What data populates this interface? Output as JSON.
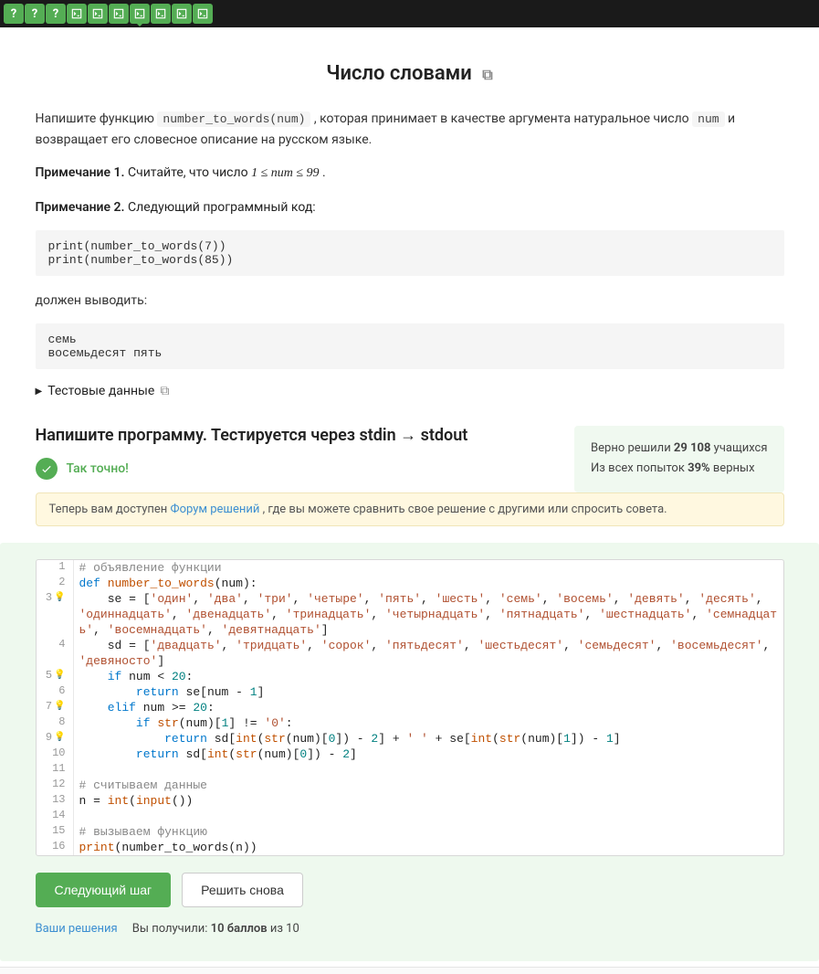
{
  "topbar": {
    "tabs": [
      {
        "kind": "q"
      },
      {
        "kind": "q"
      },
      {
        "kind": "q"
      },
      {
        "kind": "t"
      },
      {
        "kind": "t"
      },
      {
        "kind": "t"
      },
      {
        "kind": "t",
        "active": true
      },
      {
        "kind": "t"
      },
      {
        "kind": "t"
      },
      {
        "kind": "t"
      }
    ]
  },
  "title": "Число словами",
  "desc": {
    "pre": "Напишите функцию ",
    "code1": "number_to_words(num)",
    "mid": " , которая принимает в качестве аргумента натуральное число ",
    "code2": "num",
    "post": " и возвращает его словесное описание на русском языке."
  },
  "note1": {
    "label": "Примечание 1.",
    "text": " Считайте, что число ",
    "math": "1 ≤ num ≤ 99",
    "end": "."
  },
  "note2": {
    "label": "Примечание 2.",
    "text": " Следующий программный код:"
  },
  "code_example": "print(number_to_words(7))\nprint(number_to_words(85))",
  "should_output": "должен выводить:",
  "output_example": "семь\nвосемьдесят пять",
  "test_data": "Тестовые данные",
  "section_title": "Напишите программу. Тестируется через stdin → stdout",
  "correct": "Так точно!",
  "forum": {
    "pre": "Теперь вам доступен ",
    "link": "Форум решений",
    "post": " , где вы можете сравнить свое решение с другими или спросить совета."
  },
  "stats": {
    "line1_pre": "Верно решили ",
    "line1_b": "29 108",
    "line1_post": " учащихся",
    "line2_pre": "Из всех попыток ",
    "line2_b": "39%",
    "line2_post": " верных"
  },
  "code": {
    "lines": [
      {
        "n": 1,
        "bulb": false,
        "html": "<span class='c-comment'># объявление функции</span>"
      },
      {
        "n": 2,
        "bulb": false,
        "html": "<span class='c-kw'>def</span> <span class='c-def'>number_to_words</span>(num):"
      },
      {
        "n": 3,
        "bulb": true,
        "html": "    se = [<span class='c-str'>'один'</span>, <span class='c-str'>'два'</span>, <span class='c-str'>'три'</span>, <span class='c-str'>'четыре'</span>, <span class='c-str'>'пять'</span>, <span class='c-str'>'шесть'</span>, <span class='c-str'>'семь'</span>, <span class='c-str'>'восемь'</span>, <span class='c-str'>'девять'</span>, <span class='c-str'>'десять'</span>, <span class='c-str'>'одиннадцать'</span>, <span class='c-str'>'двенадцать'</span>, <span class='c-str'>'тринадцать'</span>, <span class='c-str'>'четырнадцать'</span>, <span class='c-str'>'пятнадцать'</span>, <span class='c-str'>'шестнадцать'</span>, <span class='c-str'>'семнадцать'</span>, <span class='c-str'>'восемнадцать'</span>, <span class='c-str'>'девятнадцать'</span>]"
      },
      {
        "n": 4,
        "bulb": false,
        "html": "    sd = [<span class='c-str'>'двадцать'</span>, <span class='c-str'>'тридцать'</span>, <span class='c-str'>'сорок'</span>, <span class='c-str'>'пятьдесят'</span>, <span class='c-str'>'шестьдесят'</span>, <span class='c-str'>'семьдесят'</span>, <span class='c-str'>'восемьдесят'</span>, <span class='c-str'>'девяносто'</span>]"
      },
      {
        "n": 5,
        "bulb": true,
        "html": "    <span class='c-kw'>if</span> num &lt; <span class='c-num'>20</span>:"
      },
      {
        "n": 6,
        "bulb": false,
        "html": "        <span class='c-kw'>return</span> se[num - <span class='c-num'>1</span>]"
      },
      {
        "n": 7,
        "bulb": true,
        "html": "    <span class='c-kw'>elif</span> num &gt;= <span class='c-num'>20</span>:"
      },
      {
        "n": 8,
        "bulb": false,
        "html": "        <span class='c-kw'>if</span> <span class='c-def'>str</span>(num)[<span class='c-num'>1</span>] != <span class='c-str'>'0'</span>:"
      },
      {
        "n": 9,
        "bulb": true,
        "html": "            <span class='c-kw'>return</span> sd[<span class='c-def'>int</span>(<span class='c-def'>str</span>(num)[<span class='c-num'>0</span>]) - <span class='c-num'>2</span>] + <span class='c-str'>' '</span> + se[<span class='c-def'>int</span>(<span class='c-def'>str</span>(num)[<span class='c-num'>1</span>]) - <span class='c-num'>1</span>]"
      },
      {
        "n": 10,
        "bulb": false,
        "html": "        <span class='c-kw'>return</span> sd[<span class='c-def'>int</span>(<span class='c-def'>str</span>(num)[<span class='c-num'>0</span>]) - <span class='c-num'>2</span>]"
      },
      {
        "n": 11,
        "bulb": false,
        "html": ""
      },
      {
        "n": 12,
        "bulb": false,
        "html": "<span class='c-comment'># считываем данные</span>"
      },
      {
        "n": 13,
        "bulb": false,
        "html": "n = <span class='c-def'>int</span>(<span class='c-def'>input</span>())"
      },
      {
        "n": 14,
        "bulb": false,
        "html": ""
      },
      {
        "n": 15,
        "bulb": false,
        "html": "<span class='c-comment'># вызываем функцию</span>"
      },
      {
        "n": 16,
        "bulb": false,
        "html": "<span class='c-def'>print</span>(number_to_words(n))"
      }
    ]
  },
  "buttons": {
    "next": "Следующий шаг",
    "retry": "Решить снова"
  },
  "footer": {
    "solutions": "Ваши решения",
    "score_pre": "Вы получили: ",
    "score_b": "10 баллов",
    "score_post": " из 10"
  }
}
